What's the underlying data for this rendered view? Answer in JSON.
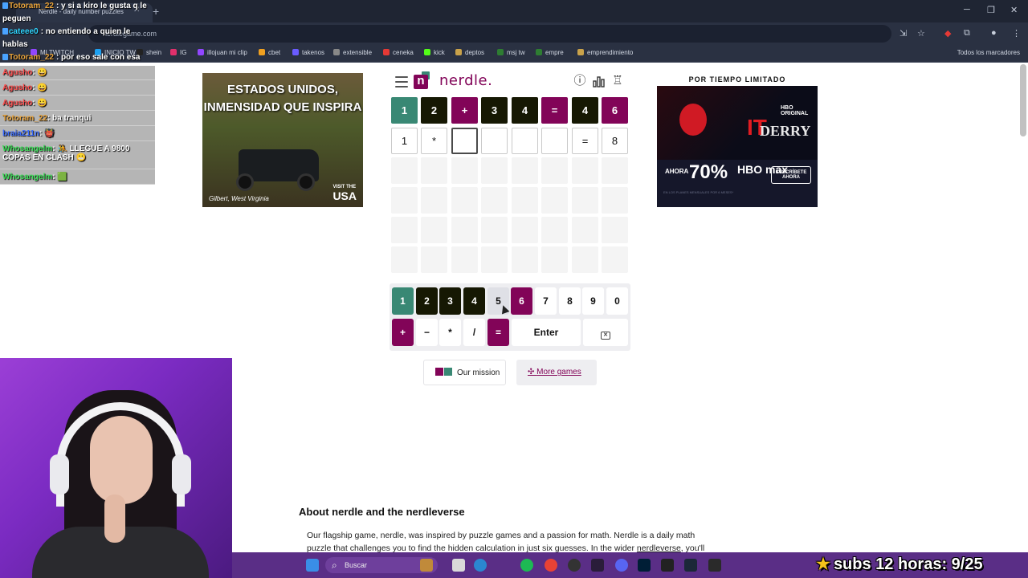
{
  "browser": {
    "tab_title": "Nerdle - daily number puzzles",
    "url": "nerdlegame.com",
    "bookmarks": [
      {
        "label": "MI TWITCH",
        "color": "#9146ff"
      },
      {
        "label": "INICIO TW",
        "color": "#1da1f2"
      },
      {
        "label": "shein",
        "color": "#222222"
      },
      {
        "label": "IG",
        "color": "#e1306c"
      },
      {
        "label": "illojuan mi clip",
        "color": "#9146ff"
      },
      {
        "label": "cbet",
        "color": "#f0a020"
      },
      {
        "label": "takenos",
        "color": "#6a5cff"
      },
      {
        "label": "extensible",
        "color": "#888888"
      },
      {
        "label": "ceneka",
        "color": "#e53935"
      },
      {
        "label": "kick",
        "color": "#53fc18"
      },
      {
        "label": "deptos",
        "color": "#c9a24a"
      },
      {
        "label": "msj tw",
        "color": "#2e7d32"
      },
      {
        "label": "empre",
        "color": "#2e7d32"
      },
      {
        "label": "emprendimiento",
        "color": "#c9a24a"
      }
    ],
    "all_bookmarks": "Todos los marcadores"
  },
  "chat": {
    "lines": [
      {
        "user": "Totoram_22",
        "user_color": "#e8a33b",
        "text": ": y si a kiro le gusta q le peguen"
      },
      {
        "user": "cateee0",
        "user_color": "#2fd5ff",
        "text": ": no entiendo a quien le hablas"
      },
      {
        "user": "Totoram_22",
        "user_color": "#e8a33b",
        "text": ": por eso sale con esa"
      }
    ],
    "rows": [
      {
        "user": "Agusho",
        "user_color": "#ff4d4d",
        "text": ": 😀"
      },
      {
        "user": "Agusho",
        "user_color": "#ff4d4d",
        "text": ": 😀"
      },
      {
        "user": "Agusho",
        "user_color": "#ff4d4d",
        "text": ": 😀"
      },
      {
        "user": "Totoram_22",
        "user_color": "#e8a33b",
        "text": ": ba tranqui"
      },
      {
        "user": "braia211n",
        "user_color": "#3a6bff",
        "text": ": 👹"
      },
      {
        "user": "Whosangelm",
        "user_color": "#3ee05a",
        "text": ": 🤼 LLEGUE A 9800 COPAS EN CLASH 😬"
      },
      {
        "user": "Whosangelm",
        "user_color": "#3ee05a",
        "text": ": 🟩"
      }
    ]
  },
  "ads": {
    "left": {
      "headline_1": "ESTADOS UNIDOS,",
      "headline_2": "INMENSIDAD QUE INSPIRA",
      "caption": "Gilbert, West Virginia",
      "visit": "VISIT THE",
      "brand": "USA"
    },
    "right": {
      "top": "POR TIEMPO LIMITADO",
      "hbo": "HBO ORIGINAL",
      "it": "IT",
      "derry": "DERRY",
      "welcome": "BIENVENIDOS A",
      "ahora": "AHORA",
      "percent": "70%",
      "hbomax": "HBO max",
      "subscribe": "SUSCRÍBETE AHORA",
      "plans": "EN LOS PLANES MENSUALES POR 6 MESES*"
    }
  },
  "nerdle": {
    "brand": "nerdle.",
    "guess_row": [
      {
        "char": "1",
        "state": "green"
      },
      {
        "char": "2",
        "state": "black"
      },
      {
        "char": "+",
        "state": "purple"
      },
      {
        "char": "3",
        "state": "black"
      },
      {
        "char": "4",
        "state": "black"
      },
      {
        "char": "=",
        "state": "purple"
      },
      {
        "char": "4",
        "state": "black"
      },
      {
        "char": "6",
        "state": "purple"
      }
    ],
    "input_row": [
      "1",
      "*",
      "",
      "",
      "",
      "",
      "=",
      "8"
    ],
    "keys_digits": [
      {
        "label": "1",
        "state": "green"
      },
      {
        "label": "2",
        "state": "black"
      },
      {
        "label": "3",
        "state": "black"
      },
      {
        "label": "4",
        "state": "black"
      },
      {
        "label": "5",
        "state": "hover"
      },
      {
        "label": "6",
        "state": "purple"
      },
      {
        "label": "7",
        "state": "white"
      },
      {
        "label": "8",
        "state": "white"
      },
      {
        "label": "9",
        "state": "white"
      },
      {
        "label": "0",
        "state": "white"
      }
    ],
    "keys_ops": [
      {
        "label": "+",
        "state": "purple"
      },
      {
        "label": "−",
        "state": "white"
      },
      {
        "label": "*",
        "state": "white"
      },
      {
        "label": "/",
        "state": "white"
      },
      {
        "label": "=",
        "state": "purple"
      }
    ],
    "enter_label": "Enter",
    "our_mission": "Our mission",
    "more_games": "More games"
  },
  "about": {
    "title": "About nerdle and the nerdleverse",
    "text_1": "Our flagship game, nerdle, was inspired by puzzle games and a passion for math. Nerdle is a daily math puzzle that challenges you to find the hidden calculation in just six guesses. In the wider ",
    "link": "nerdleverse",
    "text_2": ", you'll"
  },
  "taskbar": {
    "search": "Buscar"
  },
  "overlay": {
    "subs": "subs 12 horas: 9/25"
  }
}
